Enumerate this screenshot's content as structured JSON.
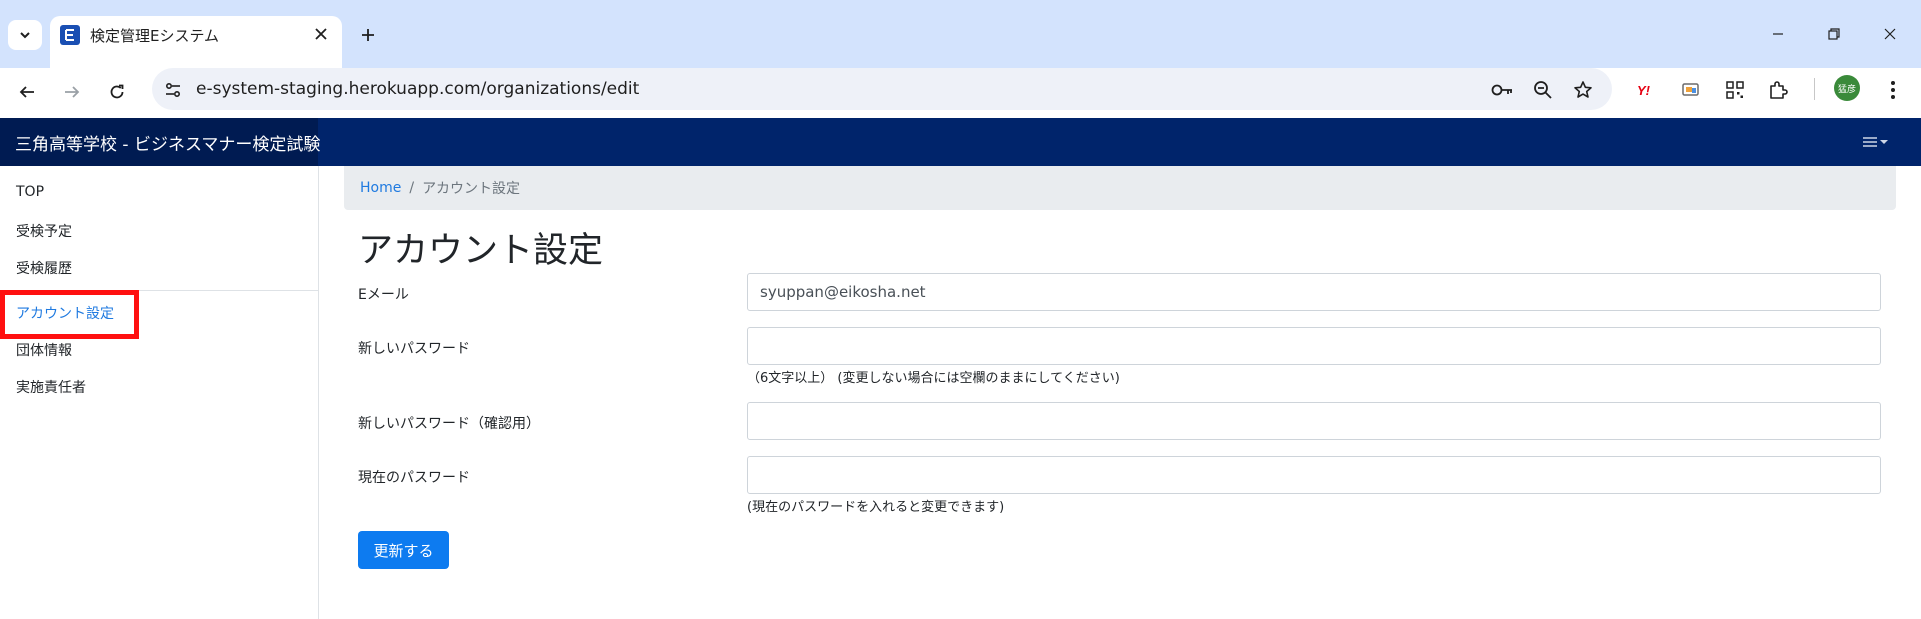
{
  "browser": {
    "tab_title": "検定管理Eシステム",
    "url": "e-system-staging.herokuapp.com/organizations/edit",
    "avatar_text": "猛彦"
  },
  "app": {
    "brand": "三角高等学校 - ビジネスマナー検定試験"
  },
  "sidebar": {
    "items": [
      {
        "label": "TOP"
      },
      {
        "label": "受検予定"
      },
      {
        "label": "受検履歴"
      },
      {
        "label": "アカウント設定"
      },
      {
        "label": "団体情報"
      },
      {
        "label": "実施責任者"
      }
    ]
  },
  "breadcrumb": {
    "home": "Home",
    "separator": "/",
    "current": "アカウント設定"
  },
  "form": {
    "title": "アカウント設定",
    "email_label": "Eメール",
    "email_value": "syuppan@eikosha.net",
    "new_password_label": "新しいパスワード",
    "new_password_help": "（6文字以上） (変更しない場合には空欄のままにしてください)",
    "confirm_password_label": "新しいパスワード（確認用）",
    "current_password_label": "現在のパスワード",
    "current_password_help": "(現在のパスワードを入れると変更できます)",
    "submit_label": "更新する"
  },
  "colors": {
    "navbar": "#00246b",
    "brand_bg": "#001b52",
    "link": "#1f7ae0",
    "primary_button": "#0d7bf0",
    "highlight_box": "#ff1010"
  }
}
